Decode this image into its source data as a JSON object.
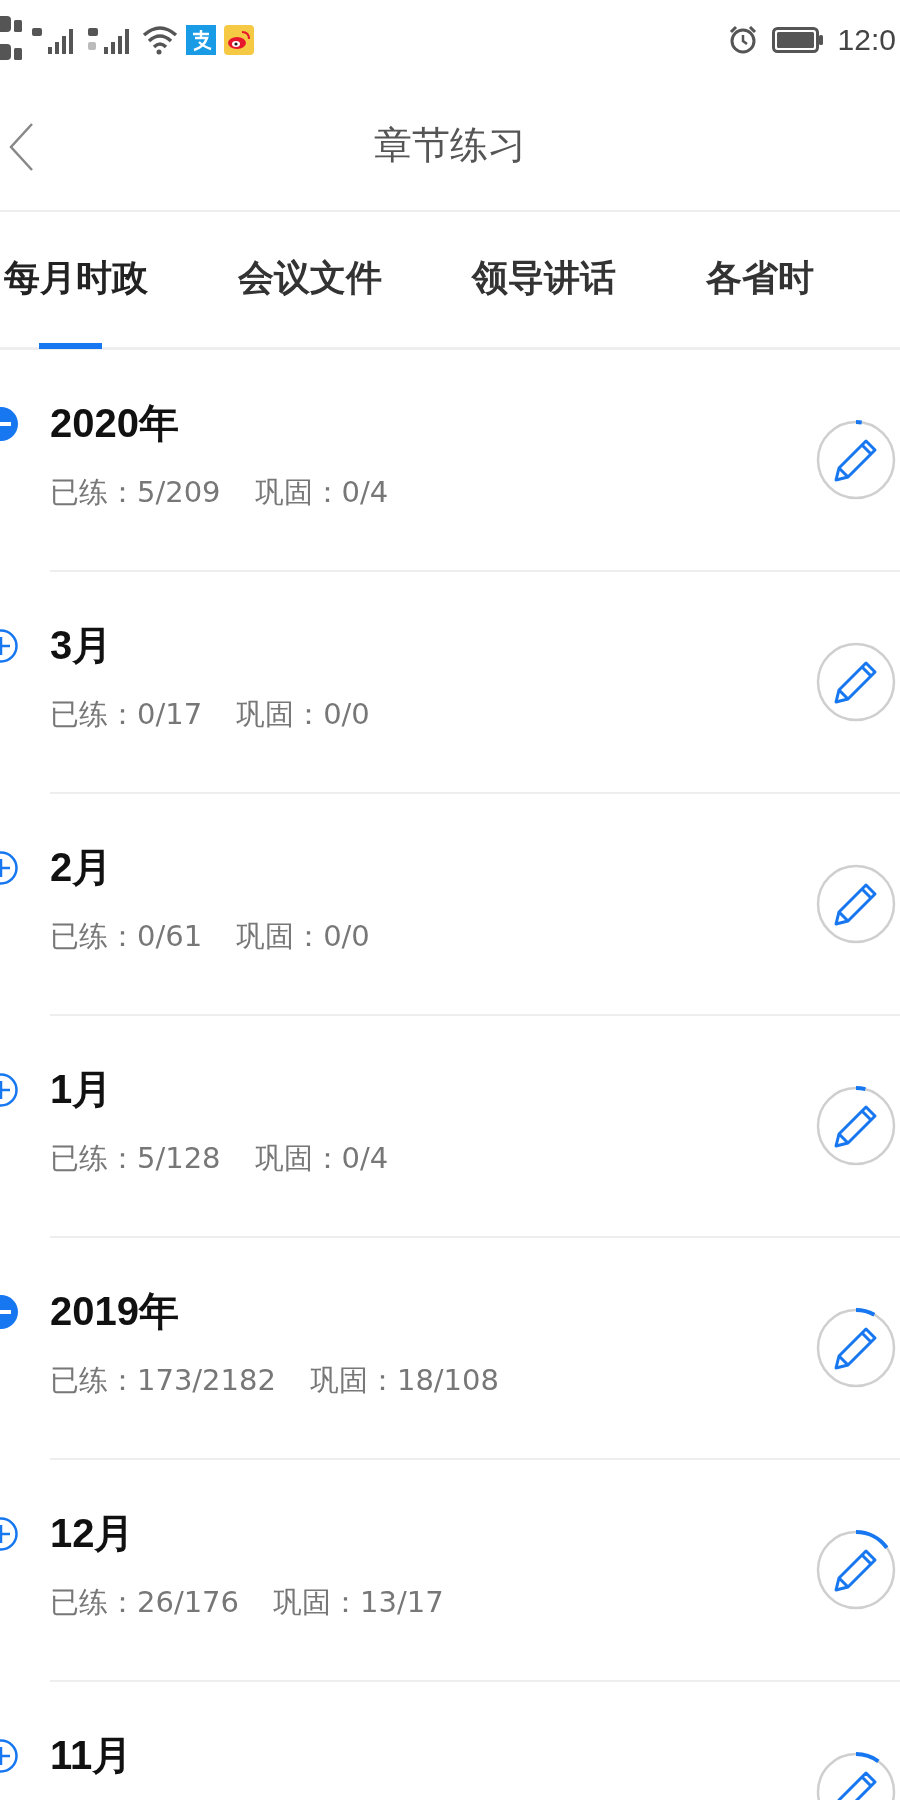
{
  "status_bar": {
    "time": "12:0"
  },
  "header": {
    "title": "章节练习"
  },
  "tabs": [
    {
      "label": "每月时政",
      "selected": true
    },
    {
      "label": "会议文件",
      "selected": false
    },
    {
      "label": "领导讲话",
      "selected": false
    },
    {
      "label": "各省时",
      "selected": false
    }
  ],
  "rows": [
    {
      "title": "2020年",
      "expanded": true,
      "practiced": "已练：5/209",
      "review": "巩固：0/4",
      "level": 0.024
    },
    {
      "title": "3月",
      "expanded": false,
      "practiced": "已练：0/17",
      "review": "巩固：0/0"
    },
    {
      "title": "2月",
      "expanded": false,
      "practiced": "已练：0/61",
      "review": "巩固：0/0"
    },
    {
      "title": "1月",
      "expanded": false,
      "practiced": "已练：5/128",
      "review": "巩固：0/4",
      "level": 0.04
    },
    {
      "title": "2019年",
      "expanded": true,
      "practiced": "已练：173/2182",
      "review": "巩固：18/108",
      "level": 0.08
    },
    {
      "title": "12月",
      "expanded": false,
      "practiced": "已练：26/176",
      "review": "巩固：13/17",
      "level": 0.15
    },
    {
      "title": "11月",
      "expanded": false,
      "level": 0.1
    }
  ]
}
